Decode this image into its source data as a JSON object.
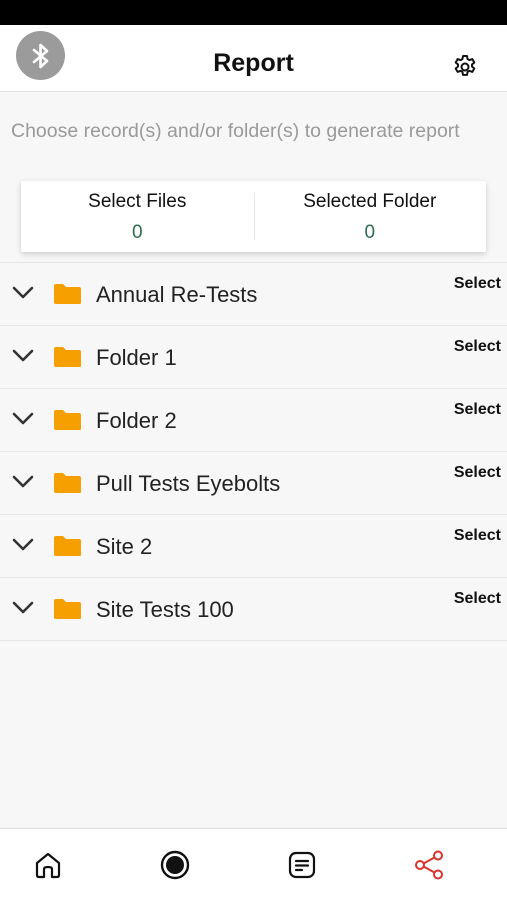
{
  "header": {
    "title": "Report"
  },
  "instructions": "Choose record(s) and/or folder(s) to generate report",
  "summary": {
    "files_label": "Select Files",
    "files_count": "0",
    "folders_label": "Selected Folder",
    "folders_count": "0"
  },
  "folders": [
    {
      "name": "Annual Re-Tests",
      "action": "Select"
    },
    {
      "name": "Folder 1",
      "action": "Select"
    },
    {
      "name": "Folder 2",
      "action": "Select"
    },
    {
      "name": "Pull Tests Eyebolts",
      "action": "Select"
    },
    {
      "name": "Site 2",
      "action": "Select"
    },
    {
      "name": "Site Tests 100",
      "action": "Select"
    }
  ],
  "icons": {
    "bluetooth": "bluetooth-icon",
    "settings": "gear-icon",
    "expand": "chevron-down-icon",
    "folder": "folder-icon",
    "nav": [
      "home-icon",
      "record-icon",
      "document-icon",
      "share-icon"
    ]
  },
  "colors": {
    "folder": "#f5a000",
    "active_nav": "#d9342b",
    "count": "#2e6b4f",
    "bluetooth_bg": "#9b9b9b"
  }
}
